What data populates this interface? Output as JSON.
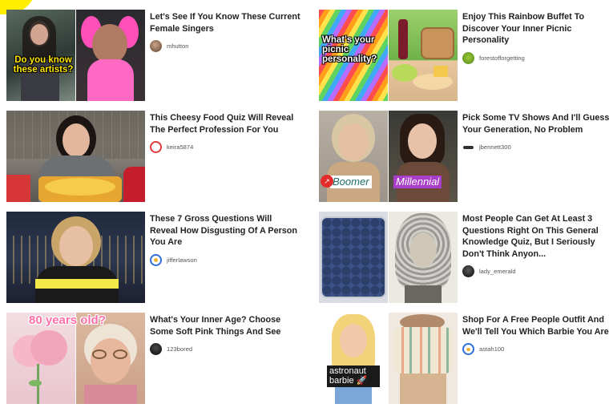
{
  "colors": {
    "accent": "#ffee00",
    "title_text": "#222222",
    "author_text": "#555555",
    "trending_badge": "#e32b2b"
  },
  "cards": [
    {
      "title": "Let's See If You Know These Current Female Singers",
      "author": "mhutton",
      "thumb_text": "Do you know these artists?"
    },
    {
      "title": "Enjoy This Rainbow Buffet To Discover Your Inner Picnic Personality",
      "author": "forestofforgetting",
      "thumb_text": "What's your picnic personality?"
    },
    {
      "title": "This Cheesy Food Quiz Will Reveal The Perfect Profession For You",
      "author": "keira5874",
      "thumb_text": ""
    },
    {
      "title": "Pick Some TV Shows And I'll Guess Your Generation, No Problem",
      "author": "jbennett300",
      "thumb_text_left": "Boomer",
      "thumb_text_right": "Millennial",
      "badge_icon": "trending-icon"
    },
    {
      "title": "These 7 Gross Questions Will Reveal How Disgusting Of A Person You Are",
      "author": "jifferlawson",
      "thumb_text": ""
    },
    {
      "title": "Most People Can Get At Least 3 Questions Right On This General Knowledge Quiz, But I Seriously Don't Think Anyon...",
      "author": "lady_emerald",
      "thumb_text": ""
    },
    {
      "title": "What's Your Inner Age? Choose Some Soft Pink Things And See",
      "author": "123bored",
      "thumb_text": "80 years old?"
    },
    {
      "title": "Shop For A Free People Outfit And We'll Tell You Which Barbie You Are",
      "author": "astah100",
      "thumb_text": "astronaut barbie 🚀"
    }
  ]
}
